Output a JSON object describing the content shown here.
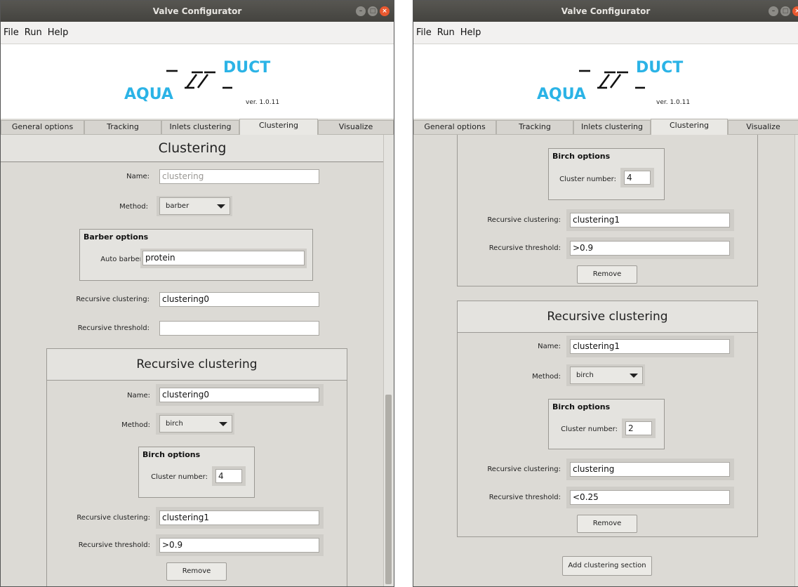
{
  "window": {
    "title": "Valve Configurator",
    "menu": [
      "File",
      "Run",
      "Help"
    ]
  },
  "logo": {
    "part_left": "AQUA",
    "part_right": "DUCT",
    "version": "ver. 1.0.11"
  },
  "tabs": [
    "General options",
    "Tracking",
    "Inlets clustering",
    "Clustering",
    "Visualize"
  ],
  "left": {
    "header": "Clustering",
    "name_label": "Name:",
    "name_placeholder": "clustering",
    "method_label": "Method:",
    "method_value": "barber",
    "barber_title": "Barber options",
    "auto_barber_label": "Auto barber:",
    "auto_barber_value": "protein",
    "rec_clustering_label": "Recursive clustering:",
    "rec_clustering_value": "clustering0",
    "rec_threshold_label": "Recursive threshold:",
    "rec_threshold_value": "",
    "section": {
      "title": "Recursive clustering",
      "name_label": "Name:",
      "name_value": "clustering0",
      "method_label": "Method:",
      "method_value": "birch",
      "birch_title": "Birch options",
      "cluster_number_label": "Cluster number:",
      "cluster_number_value": "4",
      "rec_clustering_label": "Recursive clustering:",
      "rec_clustering_value": "clustering1",
      "rec_threshold_label": "Recursive threshold:",
      "rec_threshold_value": ">0.9",
      "remove_label": "Remove"
    }
  },
  "right": {
    "top_section": {
      "birch_title": "Birch options",
      "cluster_number_label": "Cluster number:",
      "cluster_number_value": "4",
      "rec_clustering_label": "Recursive clustering:",
      "rec_clustering_value": "clustering1",
      "rec_threshold_label": "Recursive threshold:",
      "rec_threshold_value": ">0.9",
      "remove_label": "Remove"
    },
    "section": {
      "title": "Recursive clustering",
      "name_label": "Name:",
      "name_value": "clustering1",
      "method_label": "Method:",
      "method_value": "birch",
      "birch_title": "Birch options",
      "cluster_number_label": "Cluster number:",
      "cluster_number_value": "2",
      "rec_clustering_label": "Recursive clustering:",
      "rec_clustering_value": "clustering",
      "rec_threshold_label": "Recursive threshold:",
      "rec_threshold_value": "<0.25",
      "remove_label": "Remove"
    },
    "add_section_label": "Add clustering section"
  },
  "colors": {
    "logo_blue": "#2bb3e6",
    "close_button": "#e9582f",
    "titlebar": "#4b4a46"
  }
}
